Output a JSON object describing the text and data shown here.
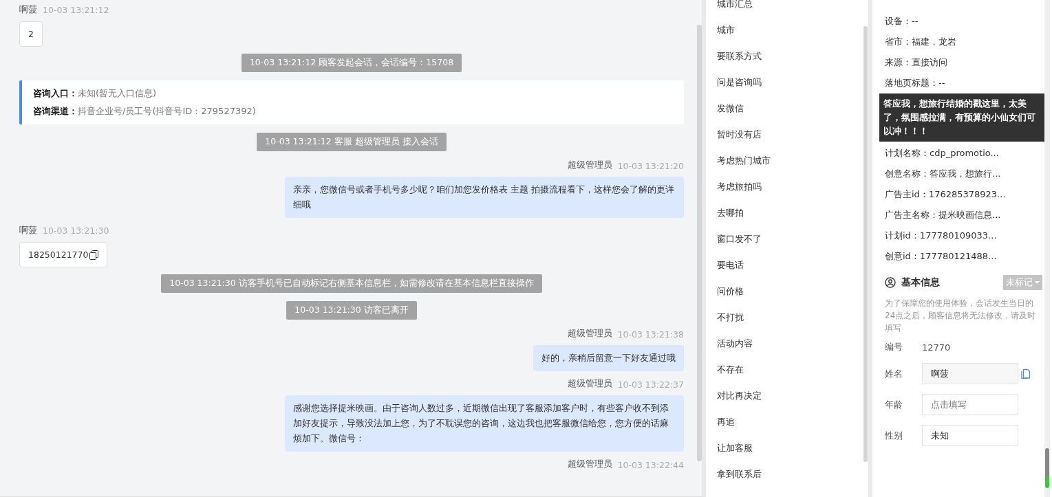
{
  "chat": {
    "messages": [
      {
        "kind": "visitor",
        "name": "啊菠",
        "time": "10-03 13:21:12",
        "text": "2"
      },
      {
        "kind": "system",
        "text": "10-03 13:21:12 顾客发起会话，会话编号：15708"
      },
      {
        "kind": "entry",
        "lines": [
          {
            "label": "咨询入口：",
            "value": "未知(暂无入口信息)"
          },
          {
            "label": "咨询渠道：",
            "value": "抖音企业号/员工号(抖音号ID：279527392)"
          }
        ]
      },
      {
        "kind": "system",
        "text": "10-03 13:21:12 客服 超级管理员 接入会话"
      },
      {
        "kind": "agent",
        "name": "超级管理员",
        "time": "10-03 13:21:20",
        "text": "亲亲，您微信号或者手机号多少呢？咱们加您发价格表 主题 拍摄流程看下，这样您会了解的更详细哦"
      },
      {
        "kind": "visitor",
        "name": "啊菠",
        "time": "10-03 13:21:30",
        "text": "18250121770",
        "copy": true
      },
      {
        "kind": "system",
        "text": "10-03 13:21:30 访客手机号已自动标记右侧基本信息栏，如需修改请在基本信息栏直接操作"
      },
      {
        "kind": "system",
        "text": "10-03 13:21:30 访客已离开"
      },
      {
        "kind": "agent",
        "name": "超级管理员",
        "time": "10-03 13:21:38",
        "text": "好的，亲稍后留意一下好友通过哦"
      },
      {
        "kind": "agent",
        "name": "超级管理员",
        "time": "10-03 13:22:37",
        "text": "感谢您选择提米映画。由于咨询人数过多，近期微信出现了客服添加客户时，有些客户收不到添加好友提示，导致没法加上您，为了不耽误您的咨询，这边我也把客服微信给您，您方便的话麻烦加下。微信号："
      },
      {
        "kind": "agent",
        "name": "超级管理员",
        "time": "10-03 13:22:44"
      }
    ]
  },
  "quick_replies": [
    "城市汇总",
    "城市",
    "要联系方式",
    "问是咨询吗",
    "发微信",
    "暂时没有店",
    "考虑热门城市",
    "考虑旅拍吗",
    "去哪拍",
    "窗口发不了",
    "要电话",
    "问价格",
    "不打扰",
    "活动内容",
    "不存在",
    "对比再决定",
    "再追",
    "让加客服",
    "拿到联系后"
  ],
  "visit_info": {
    "rows_before": [
      "设备：--",
      "省市：福建，龙岩",
      "来源：直接访问",
      "落地页标题：--"
    ],
    "tooltip": "答应我，想旅行结婚的戳这里，太美了，氛围感拉满，有预算的小仙女们可以冲！！！",
    "rows_after": [
      "计划名称：cdp_promotio...",
      "创意名称：答应我，想旅行...",
      "广告主id：176285378923...",
      "广告主名称：提米映画信息...",
      "计划id：177780109033...",
      "创意id：177780121488..."
    ]
  },
  "basic_info": {
    "title": "基本信息",
    "tag": "未标记",
    "notice": "为了保障您的使用体验，会话发生当日的24点之后，顾客信息将无法修改，请及时填写",
    "fields": [
      {
        "kind": "text",
        "label": "编号",
        "value": "12770"
      },
      {
        "kind": "input",
        "label": "姓名",
        "value": "啊菠",
        "copy": true
      },
      {
        "kind": "input",
        "label": "年龄",
        "placeholder": "点击填写"
      },
      {
        "kind": "input",
        "label": "性别",
        "value": "未知"
      }
    ]
  }
}
